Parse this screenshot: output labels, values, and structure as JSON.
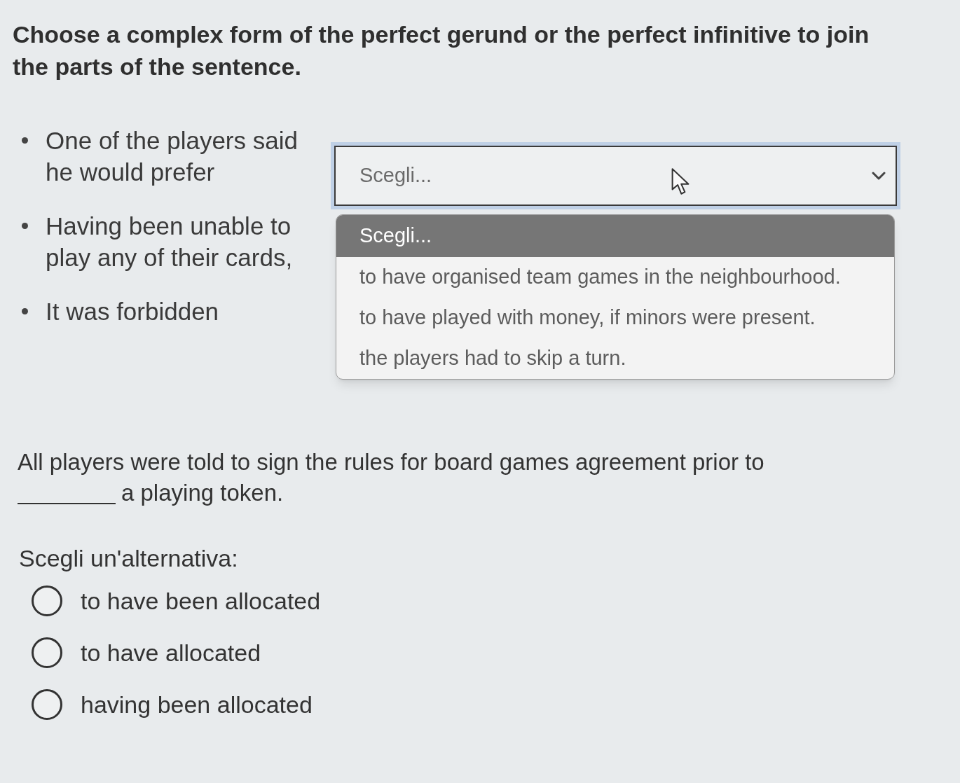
{
  "instruction": "Choose a complex form of the perfect gerund or the perfect infinitive to join the parts of the sentence.",
  "matching": [
    {
      "prompt": "One of the players said he would prefer",
      "select": {
        "value": "Scegli...",
        "expanded": true,
        "options": [
          {
            "label": "Scegli...",
            "selected": true
          },
          {
            "label": "to have organised team games in the neighbourhood.",
            "selected": false
          },
          {
            "label": "to have played with money, if minors were present.",
            "selected": false
          },
          {
            "label": "the players had to skip a turn.",
            "selected": false
          }
        ]
      }
    },
    {
      "prompt": "Having been unable to play any of their cards,"
    },
    {
      "prompt": "It was forbidden"
    }
  ],
  "question": {
    "text_before": "All players were told to sign the rules for board games agreement prior to",
    "text_after": "a playing token."
  },
  "answer_prompt": "Scegli un'alternativa:",
  "choices": [
    {
      "label": "to have been allocated",
      "selected": false
    },
    {
      "label": "to have allocated",
      "selected": false
    },
    {
      "label": "having been allocated",
      "selected": false
    }
  ]
}
